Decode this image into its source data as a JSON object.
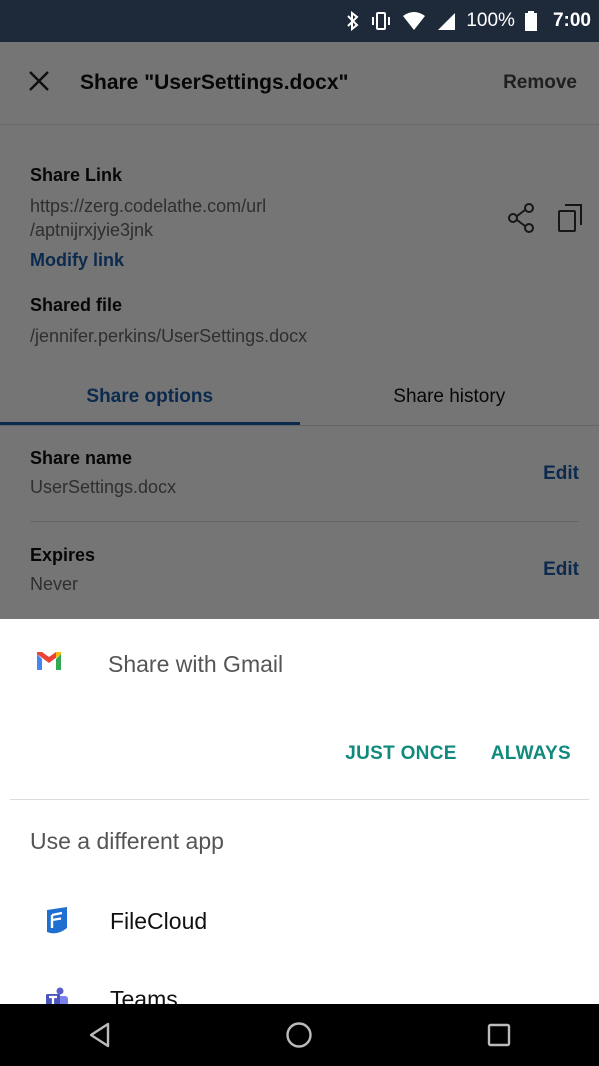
{
  "status_bar": {
    "battery": "100%",
    "time": "7:00",
    "icons": [
      "bluetooth-icon",
      "vibrate-icon",
      "wifi-icon",
      "signal-icon",
      "battery-icon"
    ]
  },
  "header": {
    "title": "Share \"UserSettings.docx\"",
    "remove_label": "Remove"
  },
  "share_link": {
    "label": "Share Link",
    "url_line1": "https://zerg.codelathe.com/url",
    "url_line2": "/aptnijrxjyie3jnk",
    "modify_label": "Modify link"
  },
  "shared_file": {
    "label": "Shared file",
    "path": "/jennifer.perkins/UserSettings.docx"
  },
  "tabs": [
    {
      "label": "Share options",
      "active": true
    },
    {
      "label": "Share history",
      "active": false
    }
  ],
  "options": [
    {
      "label": "Share name",
      "value": "UserSettings.docx",
      "action": "Edit"
    },
    {
      "label": "Expires",
      "value": "Never",
      "action": "Edit"
    }
  ],
  "sheet": {
    "primary_app": "Share with Gmail",
    "just_once": "JUST ONCE",
    "always": "ALWAYS",
    "different_app": "Use a different app",
    "apps": [
      {
        "name": "FileCloud",
        "icon": "filecloud-icon"
      },
      {
        "name": "Teams",
        "icon": "teams-icon"
      }
    ]
  },
  "colors": {
    "accent_blue": "#1a5ca8",
    "teal": "#118a7e",
    "status_bar": "#1e2a3a"
  }
}
